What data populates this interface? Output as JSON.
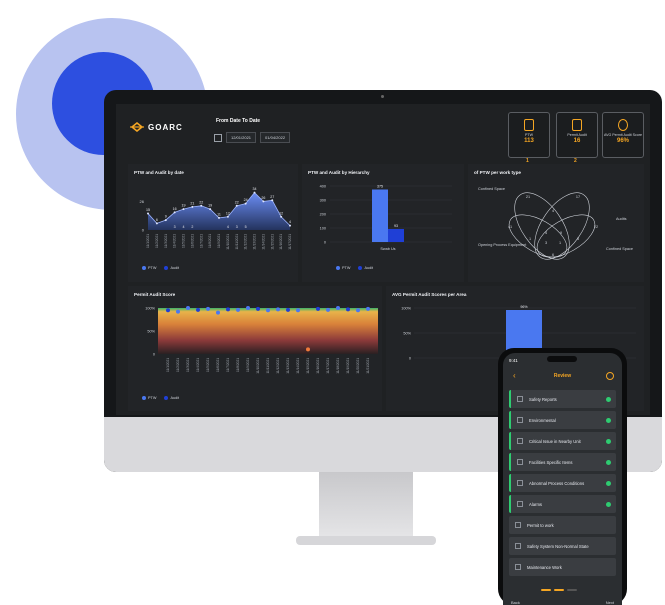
{
  "brand": {
    "name": "GOARC"
  },
  "date_filter": {
    "title": "From Date To Date",
    "from": "12/01/2021",
    "to": "01/04/2022"
  },
  "kpis": [
    {
      "label": "PTW",
      "value": "113",
      "sub": "1"
    },
    {
      "label": "Permit Audit",
      "value": "16",
      "sub": "2"
    },
    {
      "label": "AVG Permit Audit Score",
      "value": "96%"
    }
  ],
  "panels": {
    "ptw_audit_by_date": {
      "title": "PTW and Audit by date"
    },
    "ptw_audit_by_hierarchy": {
      "title": "PTW and Audit by Hierarchy"
    },
    "ptw_per_work_type": {
      "title": "of PTW per work type"
    },
    "permit_audit_score": {
      "title": "Permit Audit Score"
    },
    "avg_audit_per_area": {
      "title": "AVG Permit Audit Scores per Area"
    }
  },
  "legend": {
    "ptw": "PTW",
    "audit": "Audit"
  },
  "colors": {
    "ptw": "#4a78f0",
    "audit": "#1f3fd6",
    "accent": "#f5a623",
    "check": "#2ecc71"
  },
  "venn": {
    "sets": [
      "Confined Space",
      "Audits",
      "Confined Space",
      "Opening Process Equipment"
    ],
    "numbers": [
      "21",
      "17",
      "4",
      "41",
      "22",
      "1",
      "4",
      "9",
      "5",
      "3",
      "1",
      "6"
    ]
  },
  "chart_data": [
    {
      "type": "area",
      "title": "PTW and Audit by date",
      "x": [
        "11/1/2021",
        "11/2/2021",
        "11/3/2021",
        "11/4/2021",
        "11/5/2021",
        "11/6/2021",
        "11/7/2021",
        "11/8/2021",
        "11/9/2021",
        "11/10/2021",
        "11/11/2021",
        "11/12/2021",
        "11/13/2021",
        "11/14/2021",
        "11/15/2021",
        "11/16/2021",
        "11/17/2021"
      ],
      "series": [
        {
          "name": "PTW",
          "values": [
            15,
            6,
            9,
            16,
            19,
            21,
            22,
            19,
            11,
            12,
            22,
            24,
            34,
            26,
            27,
            12,
            4
          ]
        },
        {
          "name": "Audit",
          "values": [
            null,
            null,
            null,
            3,
            4,
            2,
            null,
            null,
            null,
            4,
            3,
            5,
            null,
            null,
            null,
            null,
            null
          ]
        }
      ],
      "yticks": [
        "26",
        "0"
      ]
    },
    {
      "type": "bar",
      "title": "PTW and Audit by Hierarchy",
      "categories": [
        "Swab Us"
      ],
      "series": [
        {
          "name": "PTW",
          "values": [
            375
          ]
        },
        {
          "name": "Audit",
          "values": [
            93
          ]
        }
      ],
      "yticks": [
        "400",
        "300",
        "200",
        "100",
        "0"
      ]
    },
    {
      "type": "heatmap",
      "title": "Permit Audit Score",
      "yticks": [
        "100%",
        "50%",
        "0"
      ],
      "x": [
        "11/1/2021",
        "11/2/2021",
        "11/3/2021",
        "11/4/2021",
        "11/5/2021",
        "11/6/2021",
        "11/7/2021",
        "11/8/2021",
        "11/9/2021",
        "11/10/2021",
        "11/11/2021",
        "11/12/2021",
        "11/13/2021",
        "11/14/2021",
        "11/15/2021",
        "11/16/2021",
        "11/17/2021",
        "11/18/2021",
        "11/19/2021",
        "11/20/2021",
        "11/21/2021"
      ],
      "points_pct": [
        95,
        92,
        100,
        96,
        98,
        90,
        97,
        96,
        100,
        98,
        95,
        97,
        96,
        95,
        10,
        98,
        96,
        100,
        97,
        95,
        98
      ]
    },
    {
      "type": "bar",
      "title": "AVG Permit Audit Scores per Area",
      "yticks": [
        "100%",
        "50%",
        "0"
      ],
      "categories": [
        ""
      ],
      "values": [
        96
      ],
      "data_labels": [
        "96%"
      ]
    }
  ],
  "phone": {
    "time": "9:41",
    "title": "Review",
    "items": [
      {
        "label": "Safety Reports",
        "done": true
      },
      {
        "label": "Environmental",
        "done": true
      },
      {
        "label": "Critical Issue in Nearby Unit",
        "done": true
      },
      {
        "label": "Facilities Specific Items",
        "done": true
      },
      {
        "label": "Abnormal Process Conditions",
        "done": true
      },
      {
        "label": "Alarms",
        "done": true
      },
      {
        "label": "Permit to work",
        "done": false
      },
      {
        "label": "Safety System Non-Normal State",
        "done": false
      },
      {
        "label": "Maintenance Work",
        "done": false
      }
    ],
    "back": "Back",
    "next": "Next"
  }
}
